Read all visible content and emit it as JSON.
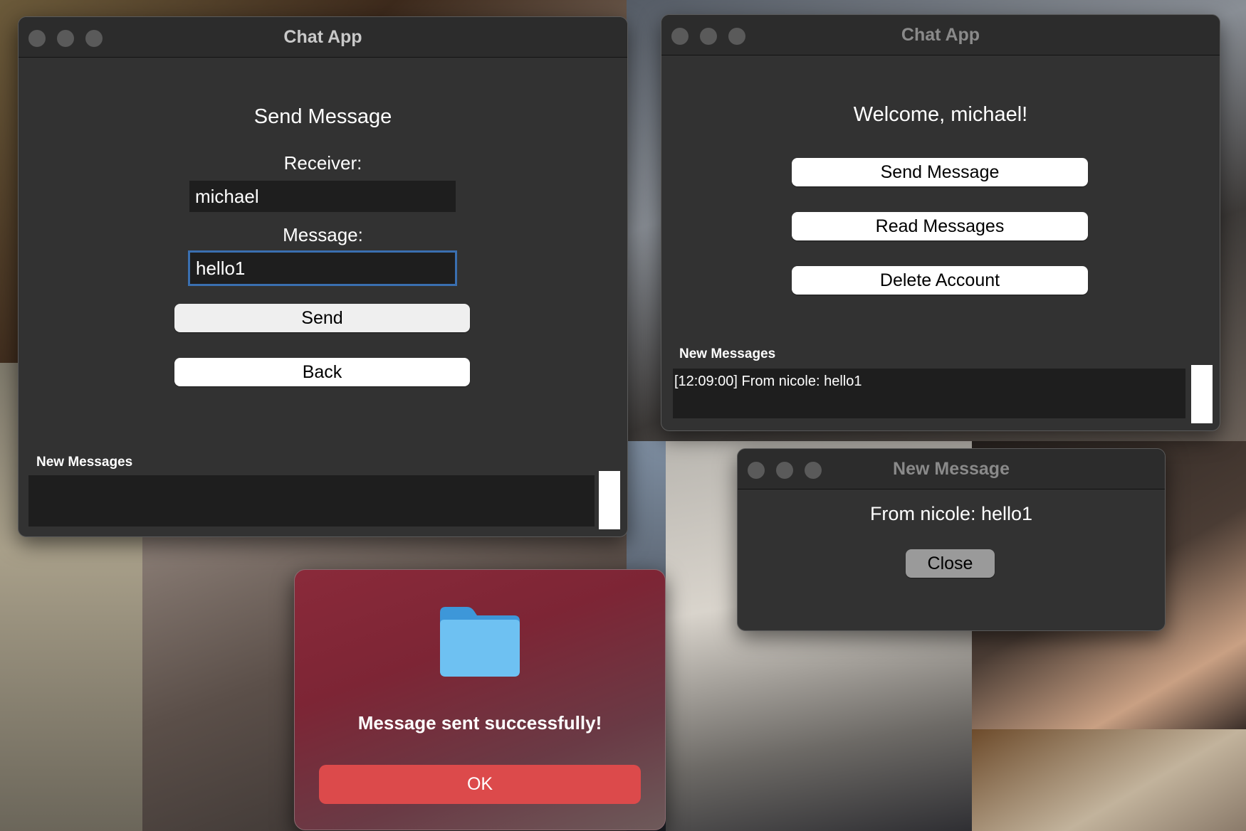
{
  "send_window": {
    "title": "Chat App",
    "heading": "Send Message",
    "receiver_label": "Receiver:",
    "receiver_value": "michael",
    "message_label": "Message:",
    "message_value": "hello1",
    "send_button": "Send",
    "back_button": "Back",
    "new_messages_label": "New Messages",
    "new_messages": []
  },
  "main_window": {
    "title": "Chat App",
    "welcome": "Welcome, michael!",
    "send_message_button": "Send Message",
    "read_messages_button": "Read Messages",
    "delete_account_button": "Delete Account",
    "new_messages_label": "New Messages",
    "new_messages": [
      "[12:09:00] From nicole: hello1"
    ]
  },
  "popup_window": {
    "title": "New Message",
    "text": "From nicole: hello1",
    "close_button": "Close"
  },
  "alert": {
    "icon": "folder-icon",
    "message": "Message sent successfully!",
    "ok_button": "OK",
    "accent_color": "#dc4a4b"
  }
}
